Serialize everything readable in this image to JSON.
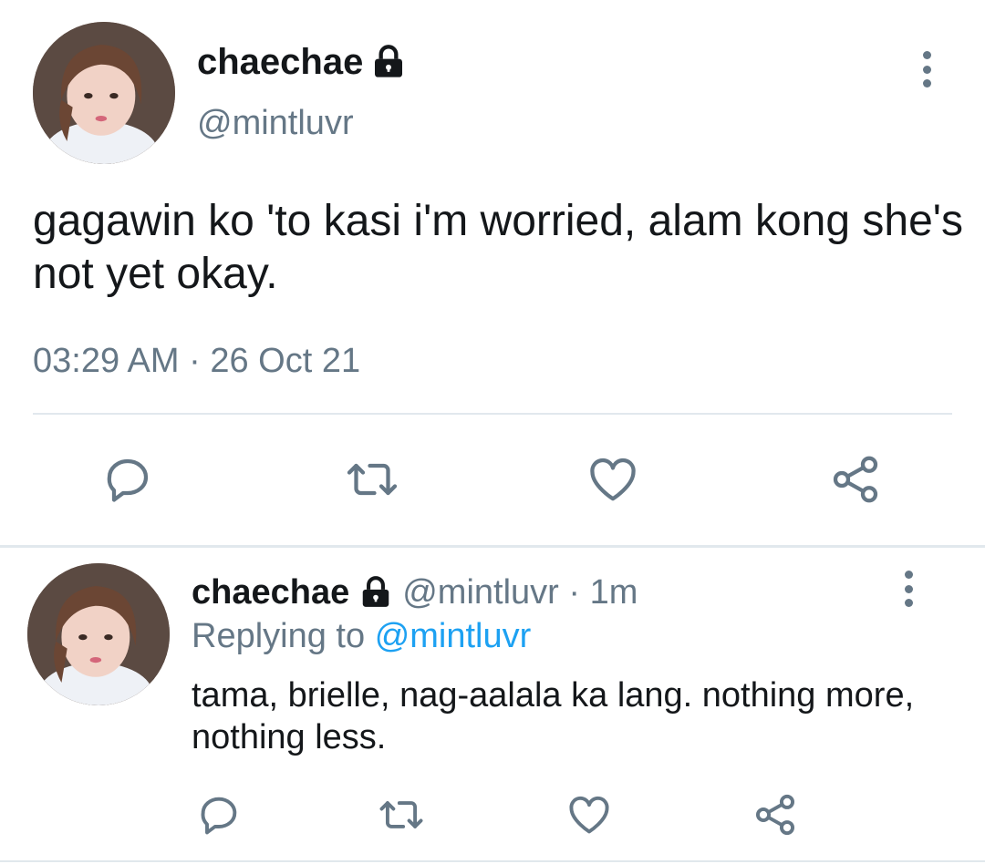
{
  "main_tweet": {
    "display_name": "chaechae",
    "handle": "@mintluvr",
    "text": "gagawin ko 'to kasi i'm worried, alam kong she's not yet okay.",
    "timestamp": "03:29 AM · 26 Oct 21",
    "avatar_icon": "avatar-photo",
    "protected_icon": "lock-icon",
    "more_icon": "more-vertical-icon"
  },
  "actions": {
    "reply_icon": "reply-icon",
    "retweet_icon": "retweet-icon",
    "like_icon": "heart-icon",
    "share_icon": "share-icon"
  },
  "reply_tweet": {
    "display_name": "chaechae",
    "handle_meta": "@mintluvr · 1m",
    "replying_prefix": "Replying to",
    "replying_to": "@mintluvr",
    "text": "tama, brielle, nag-aalala ka lang. nothing more, nothing less."
  },
  "colors": {
    "text": "#14171a",
    "muted": "#657786",
    "link": "#1da1f2",
    "divider": "#e1e8ed"
  }
}
